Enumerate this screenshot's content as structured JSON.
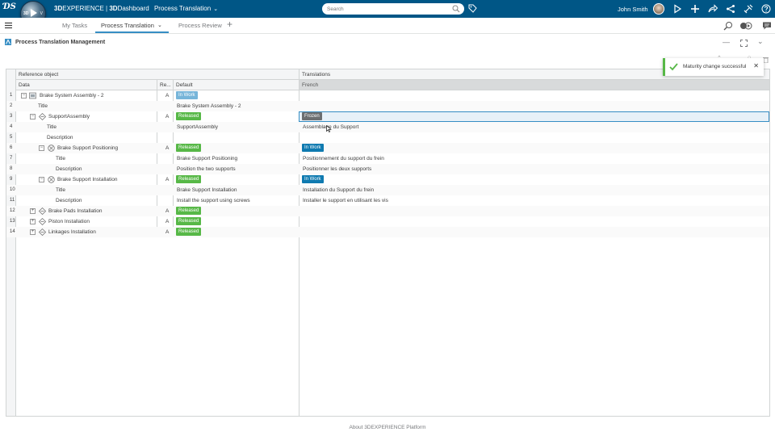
{
  "topbar": {
    "brand_bold": "3D",
    "brand_rest": "EXPERIENCE",
    "sep": " | ",
    "dashboard_bold": "3D",
    "dashboard_rest": "Dashboard",
    "dashboard_name": "Process Translation",
    "search_placeholder": "Search",
    "user_name": "John Smith",
    "compass_label": "3D",
    "compass_v": "V",
    "compass_version": "V,R"
  },
  "tabs": [
    {
      "label": "My Tasks"
    },
    {
      "label": "Process Translation"
    },
    {
      "label": "Process Review"
    }
  ],
  "widget": {
    "title": "Process Translation Management"
  },
  "toast": {
    "message": "Maturity change successful",
    "status_color": "#57b847"
  },
  "grid": {
    "group_headers": [
      "Reference object",
      "Translations"
    ],
    "columns": [
      "Data",
      "Re...",
      "Default",
      "French"
    ],
    "rows": [
      {
        "num": "1",
        "data": "Brake System Assembly - 2",
        "rev": "A",
        "default_badge": "In Work",
        "french": ""
      },
      {
        "num": "2",
        "data": "Title",
        "rev": "",
        "default": "Brake System Assembly - 2",
        "french": ""
      },
      {
        "num": "3",
        "data": "SupportAssembly",
        "rev": "A",
        "default_badge": "Released",
        "french_badge": "Frozen"
      },
      {
        "num": "4",
        "data": "Title",
        "rev": "",
        "default": "SupportAssembly",
        "french": "Assemblage du Support"
      },
      {
        "num": "5",
        "data": "Description",
        "rev": "",
        "default": "",
        "french": ""
      },
      {
        "num": "6",
        "data": "Brake Support Positioning",
        "rev": "A",
        "default_badge": "Released",
        "french_badge": "In Work"
      },
      {
        "num": "7",
        "data": "Title",
        "rev": "",
        "default": "Brake Support Positioning",
        "french": "Positionnement du support du frein"
      },
      {
        "num": "8",
        "data": "Description",
        "rev": "",
        "default": "Position the two supports",
        "french": "Positionner les deux supports"
      },
      {
        "num": "9",
        "data": "Brake Support Installation",
        "rev": "A",
        "default_badge": "Released",
        "french_badge": "In Work"
      },
      {
        "num": "10",
        "data": "Title",
        "rev": "",
        "default": "Brake Support Installation",
        "french": "Installation du Support du frein"
      },
      {
        "num": "11",
        "data": "Description",
        "rev": "",
        "default": "Install the support using screws",
        "french": "Installer le support en utilisant les vis"
      },
      {
        "num": "12",
        "data": "Brake Pads Installation",
        "rev": "A",
        "default_badge": "Released",
        "french": ""
      },
      {
        "num": "13",
        "data": "Piston Installation",
        "rev": "A",
        "default_badge": "Released",
        "french": ""
      },
      {
        "num": "14",
        "data": "Linkages Installation",
        "rev": "A",
        "default_badge": "Released",
        "french": ""
      }
    ]
  },
  "footer": {
    "text": "About 3DEXPERIENCE Platform"
  },
  "colors": {
    "topbar": "#005686",
    "released": "#57b847",
    "in_work_light": "#77b5d9",
    "in_work_dark": "#0f7ab0",
    "frozen": "#6b6e70",
    "accent": "#368ec4"
  }
}
